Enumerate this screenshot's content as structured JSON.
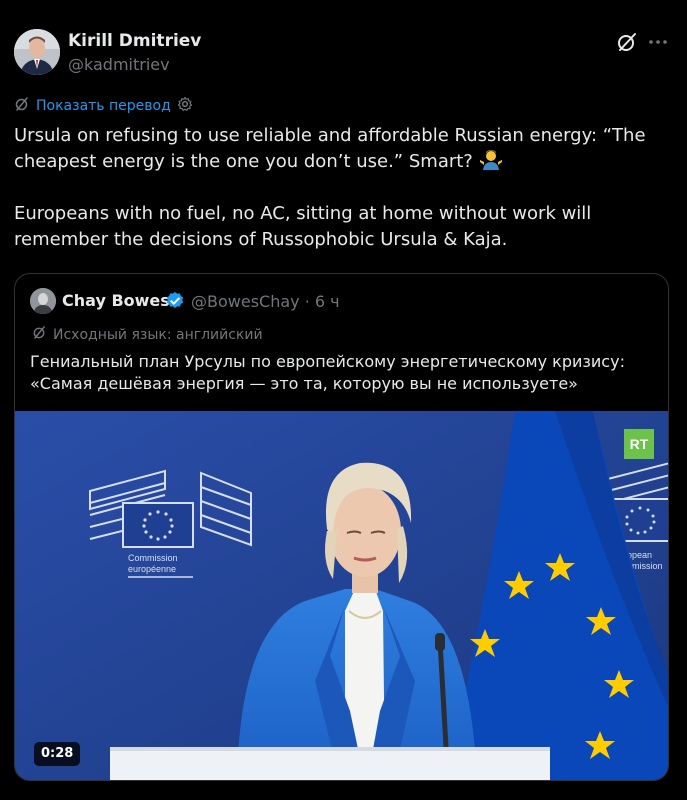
{
  "author": {
    "name": "Kirill Dmitriev",
    "handle": "@kadmitriev"
  },
  "translate": {
    "label": "Показать перевод"
  },
  "tweet": {
    "paragraph1": "Ursula on refusing to use reliable and affordable Russian energy: “The cheapest energy is the one you don’t use.”  Smart?",
    "paragraph2": "Europeans with no fuel, no AC, sitting at home without work will remember the decisions of Russophobic Ursula & Kaja."
  },
  "quote": {
    "name": "Chay Bowes",
    "handle_time": "@BowesChay · 6 ч",
    "original_language": "Исходный язык: английский",
    "text": "Гениальный план Урсулы по европейскому энергетическому кризису: «Самая дешёвая энергия — это та, которую вы не используете»"
  },
  "video": {
    "rt_logo": "RT",
    "duration": "0:28",
    "backdrop_left_lines": [
      "Commission",
      "européenne"
    ],
    "backdrop_right_lines": [
      "European",
      "Commission"
    ]
  },
  "colors": {
    "background": "#000000",
    "text": "#e7e9ea",
    "muted": "#71767b",
    "link": "#1d9bf0",
    "border": "#2f3336",
    "eu_blue": "#003399",
    "eu_star": "#ffcc00"
  },
  "icons": [
    "grok-icon",
    "more-icon",
    "translate-icon",
    "gear-icon",
    "verified-badge-icon",
    "emoji-shrug"
  ]
}
